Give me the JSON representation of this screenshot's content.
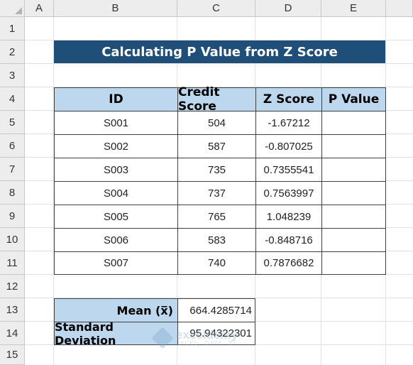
{
  "columns": [
    "A",
    "B",
    "C",
    "D",
    "E"
  ],
  "rows": [
    "1",
    "2",
    "3",
    "4",
    "5",
    "6",
    "7",
    "8",
    "9",
    "10",
    "11",
    "12",
    "13",
    "14",
    "15"
  ],
  "title": "Calculating P Value from Z Score",
  "table": {
    "headers": [
      "ID",
      "Credit Score",
      "Z Score",
      "P Value"
    ],
    "rows": [
      {
        "id": "S001",
        "score": "504",
        "z": "-1.67212",
        "p": ""
      },
      {
        "id": "S002",
        "score": "587",
        "z": "-0.807025",
        "p": ""
      },
      {
        "id": "S003",
        "score": "735",
        "z": "0.7355541",
        "p": ""
      },
      {
        "id": "S004",
        "score": "737",
        "z": "0.7563997",
        "p": ""
      },
      {
        "id": "S005",
        "score": "765",
        "z": "1.048239",
        "p": ""
      },
      {
        "id": "S006",
        "score": "583",
        "z": "-0.848716",
        "p": ""
      },
      {
        "id": "S007",
        "score": "740",
        "z": "0.7876682",
        "p": ""
      }
    ]
  },
  "stats": {
    "mean_label": "Mean (x̅)",
    "mean_value": "664.4285714",
    "sd_label": "Standard Deviation",
    "sd_value": "95.94322301"
  },
  "watermark": {
    "name": "exceldemy",
    "tagline": "EXCEL · DATA · BI"
  }
}
